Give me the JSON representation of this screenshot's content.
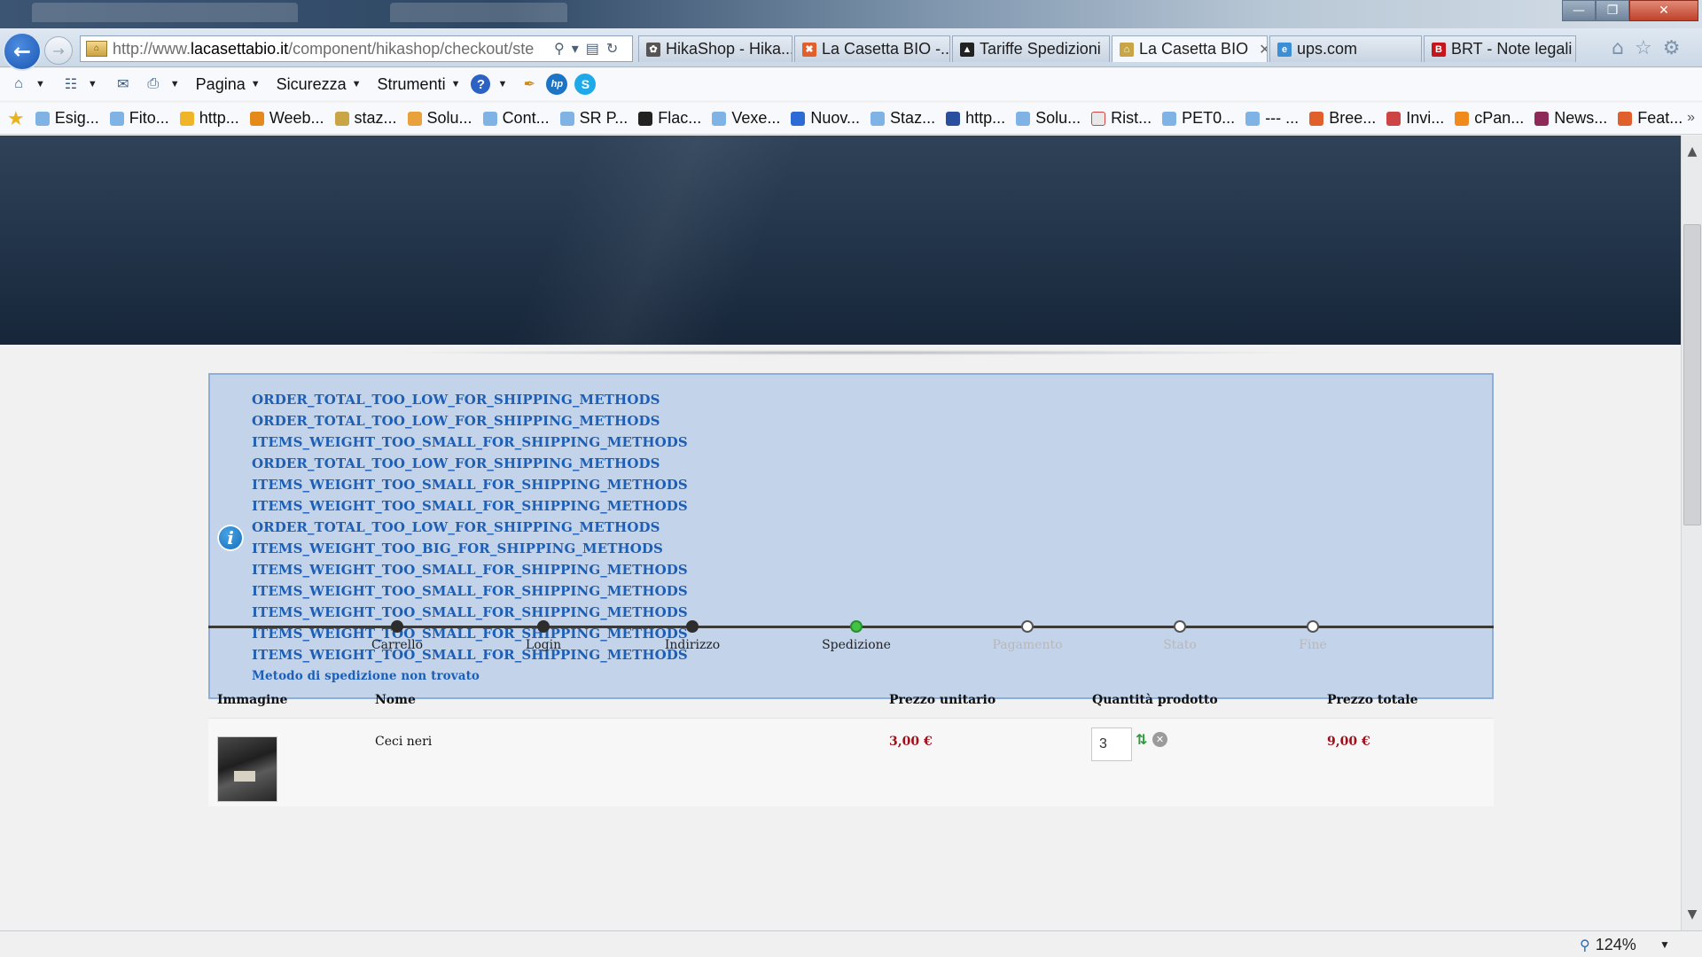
{
  "colors": {
    "accent": "#1c5fb6",
    "price": "#a0101b",
    "message_bg": "#c3d3ea",
    "step_current": "#43c245",
    "hero": "#24364c"
  },
  "browser": {
    "address": {
      "prefix": "http://www.",
      "domain": "lacasettabio.it",
      "path": "/component/hikashop/checkout/ste"
    },
    "tabs": [
      {
        "label": "HikaShop - Hika...",
        "icon": "hikashop-icon",
        "active": false
      },
      {
        "label": "La Casetta BIO -...",
        "icon": "joomla-icon",
        "active": false
      },
      {
        "label": "Tariffe Spedizioni",
        "icon": "shipping-site-icon",
        "active": false
      },
      {
        "label": "La Casetta BIO",
        "icon": "site-icon",
        "active": true
      },
      {
        "label": "ups.com",
        "icon": "ie-icon",
        "active": false
      },
      {
        "label": "BRT - Note legali",
        "icon": "brt-icon",
        "active": false
      }
    ],
    "menus": {
      "pagina": "Pagina",
      "sicurezza": "Sicurezza",
      "strumenti": "Strumenti"
    },
    "favorites": [
      "Esig...",
      "Fito...",
      "http...",
      "Weeb...",
      "staz...",
      "Solu...",
      "Cont...",
      "SR P...",
      "Flac...",
      "Vexe...",
      "Nuov...",
      "Staz...",
      "http...",
      "Solu...",
      "Rist...",
      "PET0...",
      "--- ...",
      "Bree...",
      "Invi...",
      "cPan...",
      "News...",
      "Feat..."
    ],
    "zoom": "124%"
  },
  "messages": [
    "ORDER_TOTAL_TOO_LOW_FOR_SHIPPING_METHODS",
    "ORDER_TOTAL_TOO_LOW_FOR_SHIPPING_METHODS",
    "ITEMS_WEIGHT_TOO_SMALL_FOR_SHIPPING_METHODS",
    "ORDER_TOTAL_TOO_LOW_FOR_SHIPPING_METHODS",
    "ITEMS_WEIGHT_TOO_SMALL_FOR_SHIPPING_METHODS",
    "ITEMS_WEIGHT_TOO_SMALL_FOR_SHIPPING_METHODS",
    "ORDER_TOTAL_TOO_LOW_FOR_SHIPPING_METHODS",
    "ITEMS_WEIGHT_TOO_BIG_FOR_SHIPPING_METHODS",
    "ITEMS_WEIGHT_TOO_SMALL_FOR_SHIPPING_METHODS",
    "ITEMS_WEIGHT_TOO_SMALL_FOR_SHIPPING_METHODS",
    "ITEMS_WEIGHT_TOO_SMALL_FOR_SHIPPING_METHODS",
    "ITEMS_WEIGHT_TOO_SMALL_FOR_SHIPPING_METHODS",
    "ITEMS_WEIGHT_TOO_SMALL_FOR_SHIPPING_METHODS",
    "Metodo di spedizione non trovato"
  ],
  "checkout": {
    "steps": [
      {
        "label": "Carrello",
        "state": "done"
      },
      {
        "label": "Login",
        "state": "done"
      },
      {
        "label": "Indirizzo",
        "state": "done"
      },
      {
        "label": "Spedizione",
        "state": "current"
      },
      {
        "label": "Pagamento",
        "state": "todo"
      },
      {
        "label": "Stato",
        "state": "todo"
      },
      {
        "label": "Fine",
        "state": "todo"
      }
    ],
    "columns": {
      "image": "Immagine",
      "name": "Nome",
      "unit_price": "Prezzo unitario",
      "quantity": "Quantità prodotto",
      "total_price": "Prezzo totale"
    },
    "items": [
      {
        "name": "Ceci neri",
        "unit_price": "3,00 €",
        "quantity": "3",
        "total_price": "9,00 €"
      }
    ]
  }
}
